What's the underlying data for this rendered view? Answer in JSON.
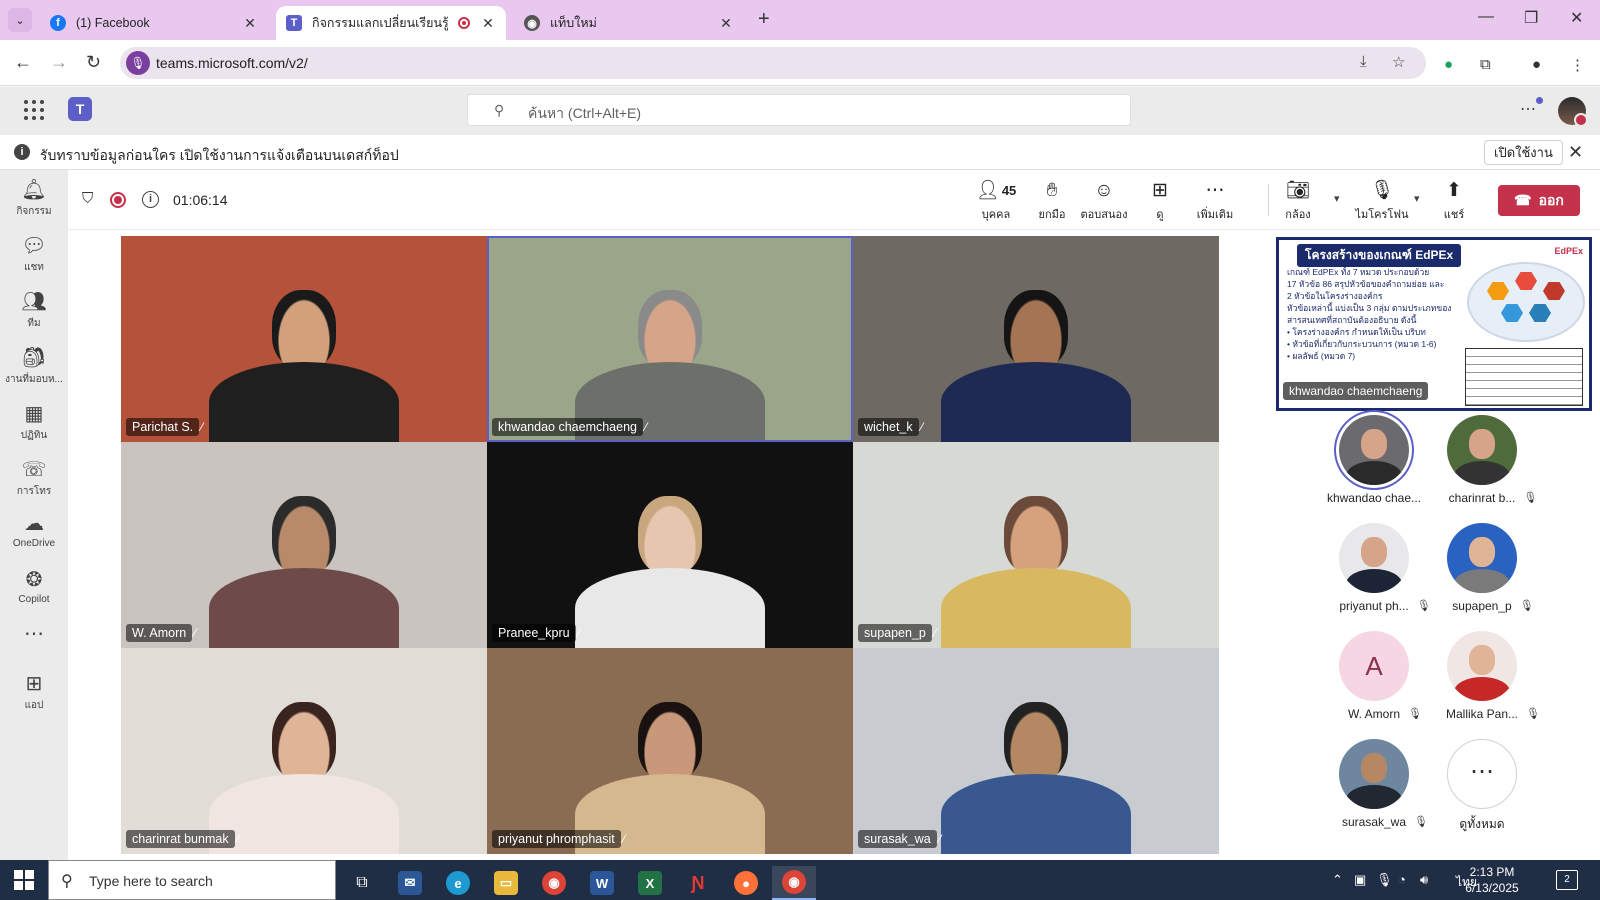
{
  "browser": {
    "tabs": [
      {
        "label": "(1) Facebook",
        "icon": "facebook-icon",
        "color": "#1877f2"
      },
      {
        "label": "กิจกรรมแลกเปลี่ยนเรียนรู้ SAR -",
        "icon": "teams-icon",
        "color": "#5b5fc7",
        "recording": true
      },
      {
        "label": "แท็บใหม่",
        "icon": "chrome-icon",
        "color": "#555555"
      }
    ],
    "url": "teams.microsoft.com/v2/"
  },
  "teams": {
    "search_placeholder": "ค้นหา (Ctrl+Alt+E)",
    "banner_text": "รับทราบข้อมูลก่อนใคร เปิดใช้งานการแจ้งเตือนบนเดสก์ท็อป",
    "banner_button": "เปิดใช้งาน",
    "rail": [
      {
        "label": "กิจกรรม",
        "icon": "bell-icon"
      },
      {
        "label": "แชท",
        "icon": "chat-icon"
      },
      {
        "label": "ทีม",
        "icon": "teams-people-icon"
      },
      {
        "label": "งานที่มอบห...",
        "icon": "assignments-icon"
      },
      {
        "label": "ปฏิทิน",
        "icon": "calendar-icon"
      },
      {
        "label": "การโทร",
        "icon": "phone-icon"
      },
      {
        "label": "OneDrive",
        "icon": "cloud-icon"
      },
      {
        "label": "Copilot",
        "icon": "copilot-icon"
      },
      {
        "label": "",
        "icon": "more-icon"
      },
      {
        "label": "แอป",
        "icon": "add-app-icon"
      }
    ]
  },
  "meeting": {
    "elapsed": "01:06:14",
    "participant_count": "45",
    "toolbar": {
      "people": "บุคคล",
      "raise": "ยกมือ",
      "react": "ตอบสนอง",
      "view": "ดู",
      "more": "เพิ่มเติม",
      "camera": "กล้อง",
      "mic": "ไมโครโฟน",
      "share": "แชร์",
      "leave": "ออก"
    },
    "tiles": [
      {
        "name": "Parichat S.",
        "bg": "#b5533a",
        "skin": "#d2a07a",
        "hair": "#1a1a1a",
        "shirt": "#1f1f1f"
      },
      {
        "name": "khwandao chaemchaeng",
        "bg": "#9aa58a",
        "skin": "#d6a488",
        "hair": "#8a8a8a",
        "shirt": "#6c6f6a",
        "speaking": true
      },
      {
        "name": "wichet_k",
        "bg": "#6e6a63",
        "skin": "#a57454",
        "hair": "#151515",
        "shirt": "#1e2a52"
      },
      {
        "name": "W. Amorn",
        "bg": "#c9c4c0",
        "skin": "#b98a6a",
        "hair": "#2b2b2b",
        "shirt": "#6f4a4a"
      },
      {
        "name": "Pranee_kpru",
        "bg": "#111111",
        "skin": "#e6c6b0",
        "hair": "#c9a77e",
        "shirt": "#e8e8e8"
      },
      {
        "name": "supapen_p",
        "bg": "#d7d9d5",
        "skin": "#d6a27e",
        "hair": "#6b4a3a",
        "shirt": "#d8b860"
      },
      {
        "name": "charinrat bunmak",
        "bg": "#e1ddd6",
        "skin": "#e0b496",
        "hair": "#3a2420",
        "shirt": "#f1e5e2"
      },
      {
        "name": "priyanut phromphasit",
        "bg": "#8a6c52",
        "skin": "#c9977a",
        "hair": "#1a1210",
        "shirt": "#d6b88e"
      },
      {
        "name": "surasak_wa",
        "bg": "#c8ccd0",
        "skin": "#b38862",
        "hair": "#222222",
        "shirt": "#3a5890"
      }
    ],
    "share": {
      "title": "โครงสร้างของเกณฑ์ EdPEx",
      "logo": "EdPEx",
      "lines": [
        "เกณฑ์ EdPEx ทั้ง 7 หมวด ประกอบด้วย",
        "17 หัวข้อ 86 สรุปหัวข้อของคำถามย่อย และ",
        "2 หัวข้อในโครงร่างองค์กร",
        "หัวข้อเหล่านี้ แบ่งเป็น 3 กลุ่ม ตามประเภทของ",
        "สารสนเทศที่สถาบันต้องอธิบาย ดังนี้",
        "• โครงร่างองค์กร กำหนดให้เป็น บริบท",
        "• หัวข้อที่เกี่ยวกับกระบวนการ (หมวด 1-6)",
        "• ผลลัพธ์ (หมวด 7)"
      ],
      "presenter": "khwandao chaemchaeng"
    },
    "roster": [
      {
        "name": "khwandao chae...",
        "kind": "photo",
        "bg": "#6b6a6e",
        "skin": "#d6a488",
        "shirt": "#2a2a2a",
        "speaking": true,
        "muted": false
      },
      {
        "name": "charinrat b...",
        "kind": "photo",
        "bg": "#4f6b3c",
        "skin": "#d6a488",
        "shirt": "#333333",
        "muted": true
      },
      {
        "name": "priyanut ph...",
        "kind": "photo",
        "bg": "#e8e8ea",
        "skin": "#d6a488",
        "shirt": "#1c2436",
        "muted": true
      },
      {
        "name": "supapen_p",
        "kind": "photo",
        "bg": "#2a62c2",
        "skin": "#e0b496",
        "shirt": "#7a7a7a",
        "muted": true
      },
      {
        "name": "W. Amorn",
        "kind": "letter",
        "letter": "A",
        "muted": true
      },
      {
        "name": "Mallika Pan...",
        "kind": "photo",
        "bg": "#f0e6e4",
        "skin": "#e0b496",
        "shirt": "#c62828",
        "muted": true
      },
      {
        "name": "surasak_wa",
        "kind": "photo",
        "bg": "#6f86a0",
        "skin": "#b38862",
        "shirt": "#222831",
        "muted": true
      },
      {
        "name": "ดูทั้งหมด",
        "kind": "more",
        "muted": false
      }
    ]
  },
  "taskbar": {
    "search_placeholder": "Type here to search",
    "lang": "ไทย",
    "time": "2:13 PM",
    "date": "6/13/2025",
    "notifications": "2"
  }
}
